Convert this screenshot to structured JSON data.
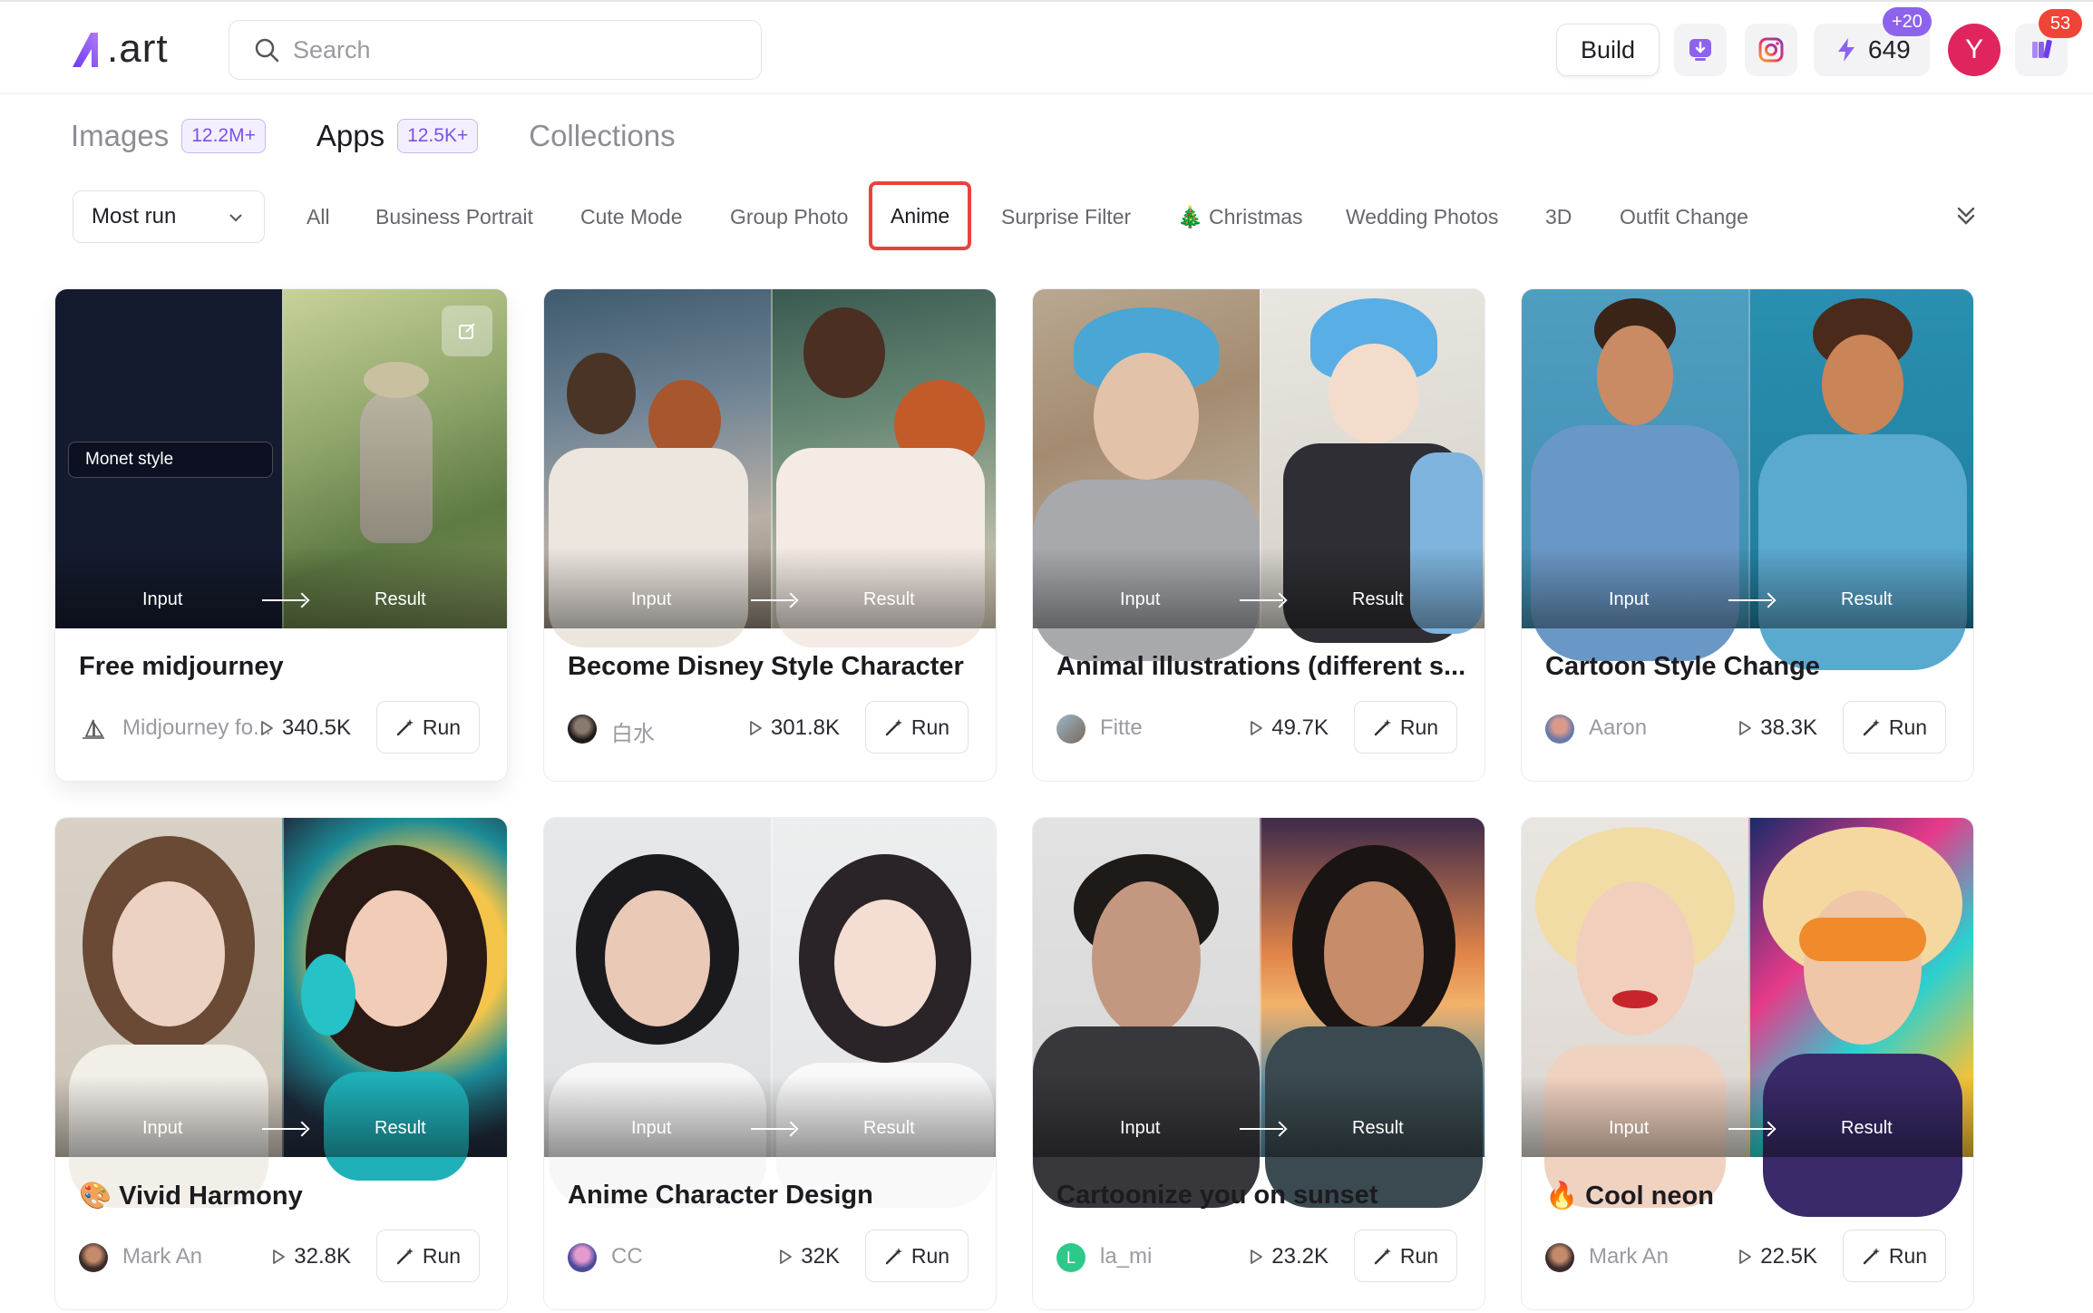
{
  "header": {
    "logo_text": ".art",
    "search_placeholder": "Search",
    "build_label": "Build",
    "credits": "649",
    "credits_bonus": "+20",
    "avatar_initial": "Y",
    "notifications": "53"
  },
  "tabs": [
    {
      "label": "Images",
      "count": "12.2M+"
    },
    {
      "label": "Apps",
      "count": "12.5K+"
    },
    {
      "label": "Collections",
      "count": ""
    }
  ],
  "filters": {
    "sort_label": "Most run",
    "chips": [
      "All",
      "Business Portrait",
      "Cute Mode",
      "Group Photo",
      "Anime",
      "Surprise Filter",
      "🎄 Christmas",
      "Wedding Photos",
      "3D",
      "Outfit Change"
    ],
    "active_chip": "Anime"
  },
  "labels": {
    "input": "Input",
    "result": "Result",
    "run": "Run"
  },
  "cards": [
    {
      "title": "Free midjourney",
      "author": "Midjourney fo...",
      "runs": "340.5K",
      "style_pill": "Monet style"
    },
    {
      "title": "Become Disney Style Character",
      "author": "白水",
      "runs": "301.8K"
    },
    {
      "title": "Animal illustrations (different s...",
      "author": "Fitte",
      "runs": "49.7K"
    },
    {
      "title": "Cartoon Style Change",
      "author": "Aaron",
      "runs": "38.3K"
    },
    {
      "title": "🎨 Vivid Harmony",
      "author": "Mark An",
      "runs": "32.8K"
    },
    {
      "title": "Anime Character Design",
      "author": "CC",
      "runs": "32K"
    },
    {
      "title": "Cartoonize you on sunset",
      "author": "la_mi",
      "runs": "23.2K"
    },
    {
      "title": "🔥 Cool neon",
      "author": "Mark An",
      "runs": "22.5K"
    }
  ],
  "colors": {
    "accent": "#7a52e6",
    "active_chip_border": "#e8433b",
    "avatar": "#e0245e",
    "badge_red": "#f04438"
  }
}
